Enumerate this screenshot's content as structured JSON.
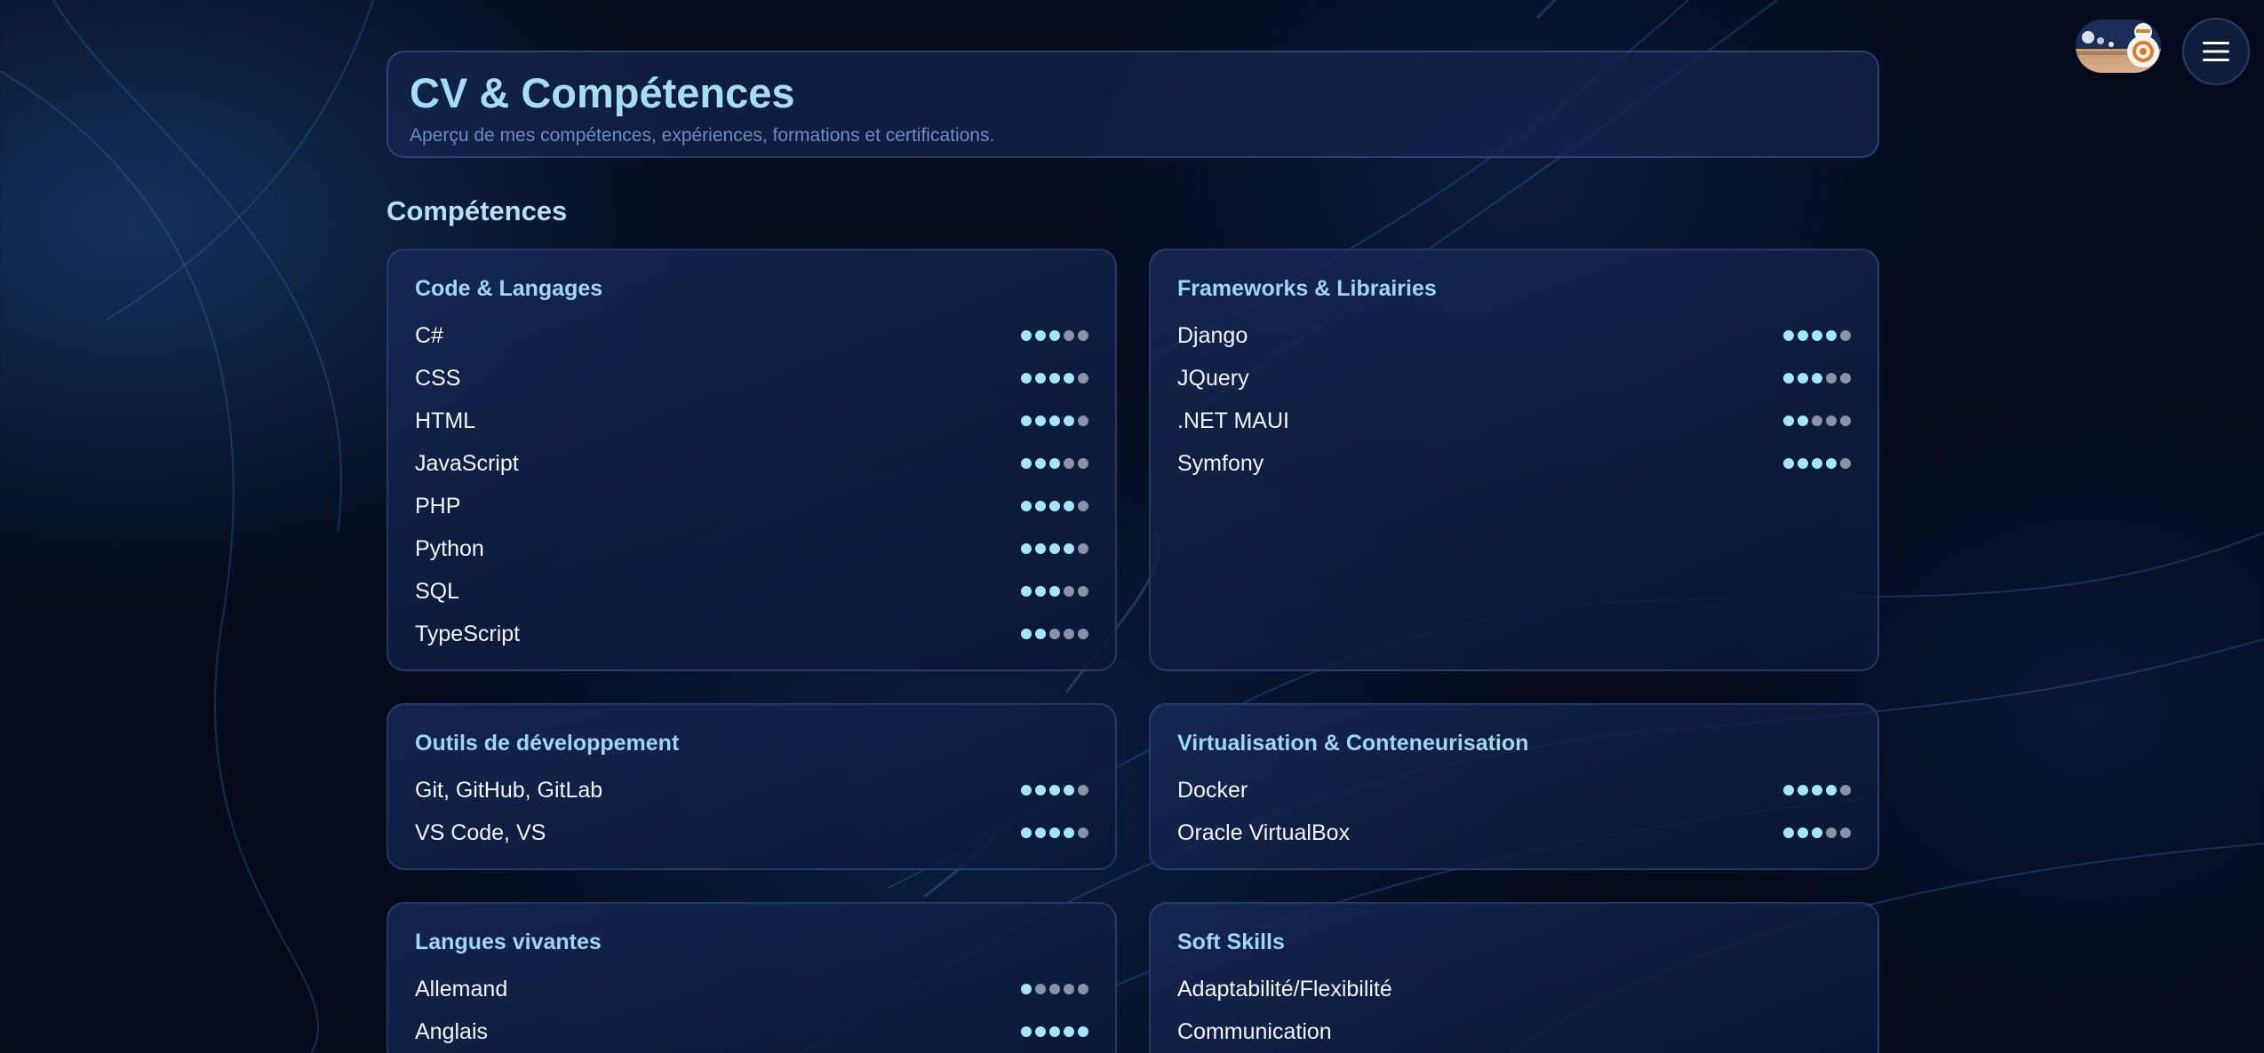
{
  "header": {
    "title": "CV & Compétences",
    "subtitle": "Aperçu de mes compétences, expériences, formations et certifications."
  },
  "nav": {
    "avatar_icon": "bb8-robot-avatar-icon",
    "menu_icon": "hamburger-menu-icon"
  },
  "skills_section": {
    "title": "Compétences",
    "max_level": 5,
    "categories": [
      {
        "title": "Code & Langages",
        "items": [
          {
            "name": "C#",
            "level": 3
          },
          {
            "name": "CSS",
            "level": 4
          },
          {
            "name": "HTML",
            "level": 4
          },
          {
            "name": "JavaScript",
            "level": 3
          },
          {
            "name": "PHP",
            "level": 4
          },
          {
            "name": "Python",
            "level": 4
          },
          {
            "name": "SQL",
            "level": 3
          },
          {
            "name": "TypeScript",
            "level": 2
          }
        ]
      },
      {
        "title": "Frameworks & Librairies",
        "items": [
          {
            "name": "Django",
            "level": 4
          },
          {
            "name": "JQuery",
            "level": 3
          },
          {
            "name": ".NET MAUI",
            "level": 2
          },
          {
            "name": "Symfony",
            "level": 4
          }
        ]
      },
      {
        "title": "Outils de développement",
        "items": [
          {
            "name": "Git, GitHub, GitLab",
            "level": 4
          },
          {
            "name": "VS Code, VS",
            "level": 4
          }
        ]
      },
      {
        "title": "Virtualisation & Conteneurisation",
        "items": [
          {
            "name": "Docker",
            "level": 4
          },
          {
            "name": "Oracle VirtualBox",
            "level": 3
          }
        ]
      },
      {
        "title": "Langues vivantes",
        "items": [
          {
            "name": "Allemand",
            "level": 1
          },
          {
            "name": "Anglais",
            "level": 5
          }
        ]
      },
      {
        "title": "Soft Skills",
        "items": [
          {
            "name": "Adaptabilité/Flexibilité",
            "level": null
          },
          {
            "name": "Communication",
            "level": null
          }
        ]
      }
    ]
  },
  "colors": {
    "accent": "#a2e6ff",
    "dot_off": "#8a93a6",
    "title": "#a5ddf6",
    "background": "#050c1e"
  }
}
